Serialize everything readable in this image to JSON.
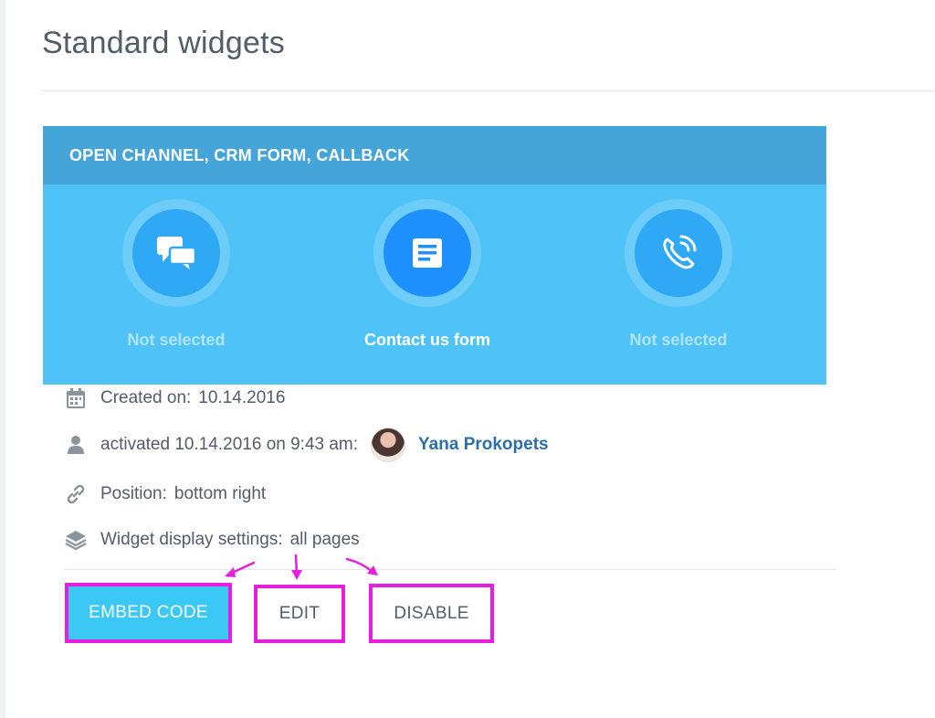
{
  "page": {
    "title": "Standard widgets"
  },
  "widget": {
    "header": "OPEN CHANNEL, CRM FORM, CALLBACK",
    "channels": [
      {
        "icon": "chat-bubbles-icon",
        "label": "Not selected",
        "active": false
      },
      {
        "icon": "form-document-icon",
        "label": "Contact us form",
        "active": true
      },
      {
        "icon": "phone-call-icon",
        "label": "Not selected",
        "active": false
      }
    ]
  },
  "details": {
    "created_label": "Created on:",
    "created_value": "10.14.2016",
    "activated_label": "activated 10.14.2016 on 9:43 am:",
    "activated_user": "Yana Prokopets",
    "position_label": "Position:",
    "position_value": "bottom right",
    "display_label": "Widget display settings:",
    "display_value": "all pages"
  },
  "actions": {
    "embed_label": "EMBED CODE",
    "edit_label": "EDIT",
    "disable_label": "DISABLE"
  },
  "colors": {
    "card_body": "#4fc3f7",
    "card_header": "#45a5d9",
    "active_disc": "#1e90ff",
    "embed_button": "#3bc8f5",
    "highlight": "#e61ee0",
    "user_link": "#2d6fa8"
  }
}
